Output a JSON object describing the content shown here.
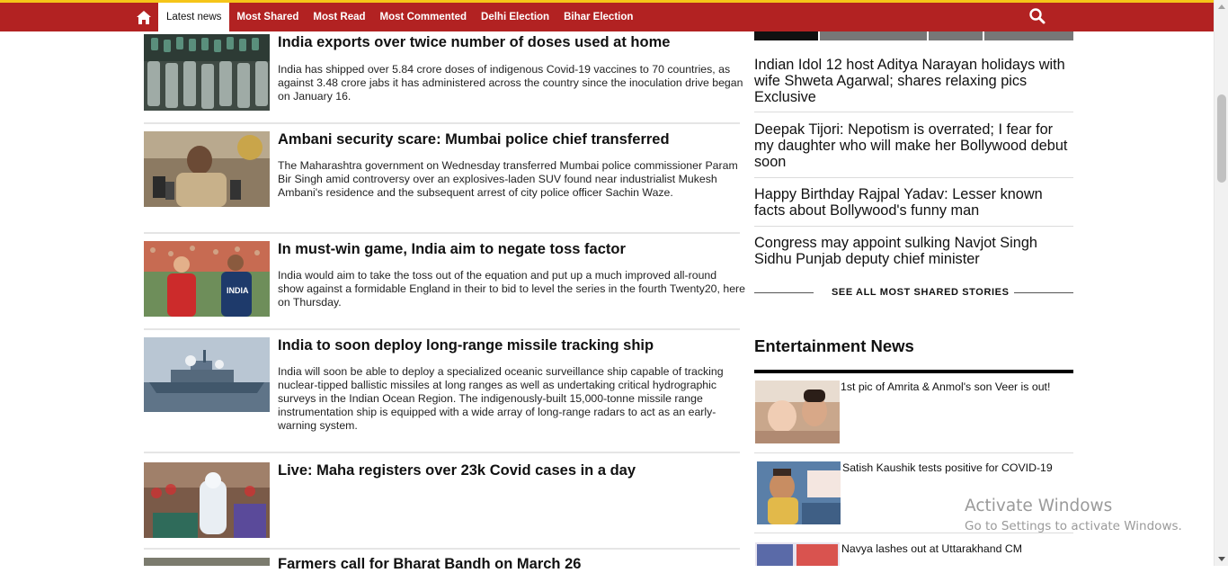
{
  "nav": {
    "home_icon": "home-icon",
    "items": [
      {
        "label": "Latest news",
        "active": true
      },
      {
        "label": "Most Shared"
      },
      {
        "label": "Most Read"
      },
      {
        "label": "Most Commented"
      },
      {
        "label": "Delhi Election"
      },
      {
        "label": "Bihar Election"
      }
    ],
    "search_icon": "search-icon",
    "colors": {
      "bar": "#b22222",
      "accent": "#f5c518"
    }
  },
  "stories": [
    {
      "title": "India exports over twice number of doses used at home",
      "summary": "India has shipped over 5.84 crore doses of indigenous Covid-19 vaccines to 70 countries, as against 3.48 crore jabs it has administered across the country since the inoculation drive began on January 16."
    },
    {
      "title": "Ambani security scare: Mumbai police chief transferred",
      "summary": "The Maharashtra government on Wednesday transferred Mumbai police commissioner Param Bir Singh amid controversy over an explosives-laden SUV found near industrialist Mukesh Ambani's residence and the subsequent arrest of city police officer Sachin Waze."
    },
    {
      "title": "In must-win game, India aim to negate toss factor",
      "summary": "India would aim to take the toss out of the equation and put up a much improved all-round show against a formidable England in their to bid to level the series in the fourth Twenty20, here on Thursday."
    },
    {
      "title": "India to soon deploy long-range missile tracking ship",
      "summary": "India will soon be able to deploy a specialized oceanic surveillance ship capable of tracking nuclear-tipped ballistic missiles at long ranges as well as undertaking critical hydrographic surveys in the Indian Ocean Region. The indigenously-built 15,000-tonne missile range instrumentation ship is equipped with a wide array of long-range radars to act as an early-warning system."
    },
    {
      "title": "Live: Maha registers over 23k Covid cases in a day",
      "summary": ""
    },
    {
      "title": "Farmers call for Bharat Bandh on March 26",
      "summary": ""
    }
  ],
  "most_shared": {
    "items": [
      "Indian Idol 12 host Aditya Narayan holidays with wife Shweta Agarwal; shares relaxing pics Exclusive",
      "Deepak Tijori: Nepotism is overrated; I fear for my daughter who will make her Bollywood debut soon",
      "Happy Birthday Rajpal Yadav: Lesser known facts about Bollywood's funny man",
      "Congress may appoint sulking Navjot Singh Sidhu Punjab deputy chief minister"
    ],
    "see_all": "SEE ALL MOST SHARED STORIES"
  },
  "entertainment": {
    "heading": "Entertainment News",
    "items": [
      "1st pic of Amrita & Anmol's son Veer is out!",
      "Satish Kaushik tests positive for COVID-19",
      "Navya lashes out at Uttarakhand CM"
    ]
  },
  "watermark": {
    "line1": "Activate Windows",
    "line2": "Go to Settings to activate Windows."
  }
}
